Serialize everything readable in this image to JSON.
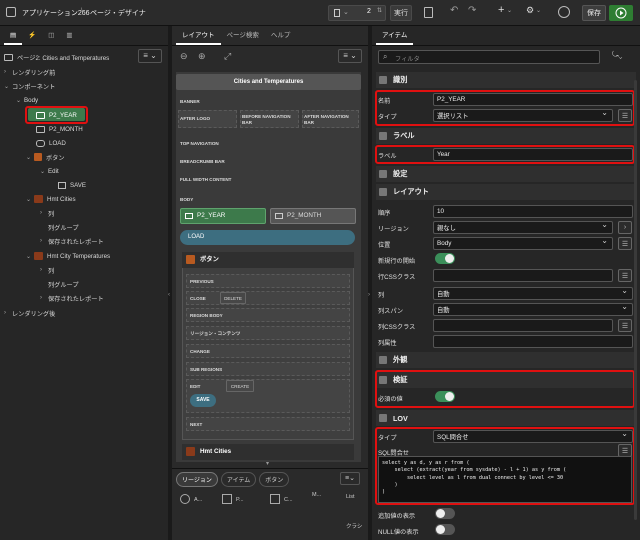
{
  "app": {
    "title": "アプリケーション266",
    "separator": "\\",
    "page_title": "ページ・デザイナ"
  },
  "toolbar": {
    "page_number": "2",
    "run_label": "実行",
    "save_label": "保存",
    "undo": "↶",
    "redo": "↷",
    "add": "+",
    "wrench": "⚙"
  },
  "left_panel": {
    "tabs": [
      "▤",
      "⚡",
      "◫",
      "▥"
    ],
    "root": "ページ2: Cities and Temperatures",
    "items": [
      {
        "label": "レンダリング前"
      },
      {
        "label": "コンポーネント"
      },
      {
        "label": "Body"
      },
      {
        "label": "P2_YEAR"
      },
      {
        "label": "P2_MONTH"
      },
      {
        "label": "LOAD"
      },
      {
        "label": "ボタン"
      },
      {
        "label": "Edit"
      },
      {
        "label": "SAVE"
      },
      {
        "label": "Hmt Cities"
      },
      {
        "label": "列"
      },
      {
        "label": "列グループ"
      },
      {
        "label": "保存されたレポート"
      },
      {
        "label": "Hmt City Temperatures"
      },
      {
        "label": "列"
      },
      {
        "label": "列グループ"
      },
      {
        "label": "保存されたレポート"
      },
      {
        "label": "レンダリング後"
      }
    ]
  },
  "middle": {
    "tabs": [
      "レイアウト",
      "ページ検索",
      "ヘルプ"
    ],
    "page_header": "Cities and Temperatures",
    "positions": [
      "BANNER",
      "AFTER LOGO",
      "BEFORE NAVIGATION BAR",
      "AFTER NAVIGATION BAR",
      "TOP NAVIGATION",
      "BREADCRUMB BAR",
      "FULL WIDTH CONTENT",
      "BODY"
    ],
    "body_items": {
      "year": "P2_YEAR",
      "month": "P2_MONTH",
      "load": "LOAD"
    },
    "button_region": {
      "title": "ボタン",
      "slots": [
        "PREVIOUS",
        "CLOSE",
        "DELETE",
        "REGION BODY",
        "リージョン・コンテンツ",
        "CHANGE",
        "SUB REGIONS",
        "EDIT",
        "CREATE",
        "SAVE",
        "NEXT"
      ]
    },
    "hmt_title": "Hmt Cities",
    "bottom_tabs": [
      "リージョン",
      "アイテム",
      "ボタン"
    ],
    "bottom_items": [
      "A...",
      "P...",
      "C...",
      "M...",
      "List",
      "クラシ"
    ]
  },
  "right_panel": {
    "tab": "アイテム",
    "filter_placeholder": "フィルタ",
    "sections": {
      "ident": "識別",
      "label": "ラベル",
      "settings": "設定",
      "layout": "レイアウト",
      "appearance": "外観",
      "validation": "検証",
      "lov": "LOV"
    },
    "fields": {
      "name_label": "名前",
      "name_value": "P2_YEAR",
      "type_label": "タイプ",
      "type_value": "選択リスト",
      "label_label": "ラベル",
      "label_value": "Year",
      "seq_label": "順序",
      "seq_value": "10",
      "region_label": "リージョン",
      "region_value": "親なし",
      "position_label": "位置",
      "position_value": "Body",
      "newrow_label": "新規行の開始",
      "rowcss_label": "行CSSクラス",
      "col_label": "列",
      "col_value": "自動",
      "colspan_label": "列スパン",
      "colspan_value": "自動",
      "colcss_label": "列CSSクラス",
      "colattr_label": "列属性",
      "required_label": "必須の値",
      "lovtype_label": "タイプ",
      "lovtype_value": "SQL問合せ",
      "sql_label": "SQL問合せ",
      "sql_code": "select y as d, y as r from (\n    select (extract(year from sysdate) - l + 1) as y from (\n        select level as l from dual connect by level <= 30\n    )\n)",
      "extra_label": "追加値の表示",
      "null_label": "NULL値の表示"
    }
  }
}
